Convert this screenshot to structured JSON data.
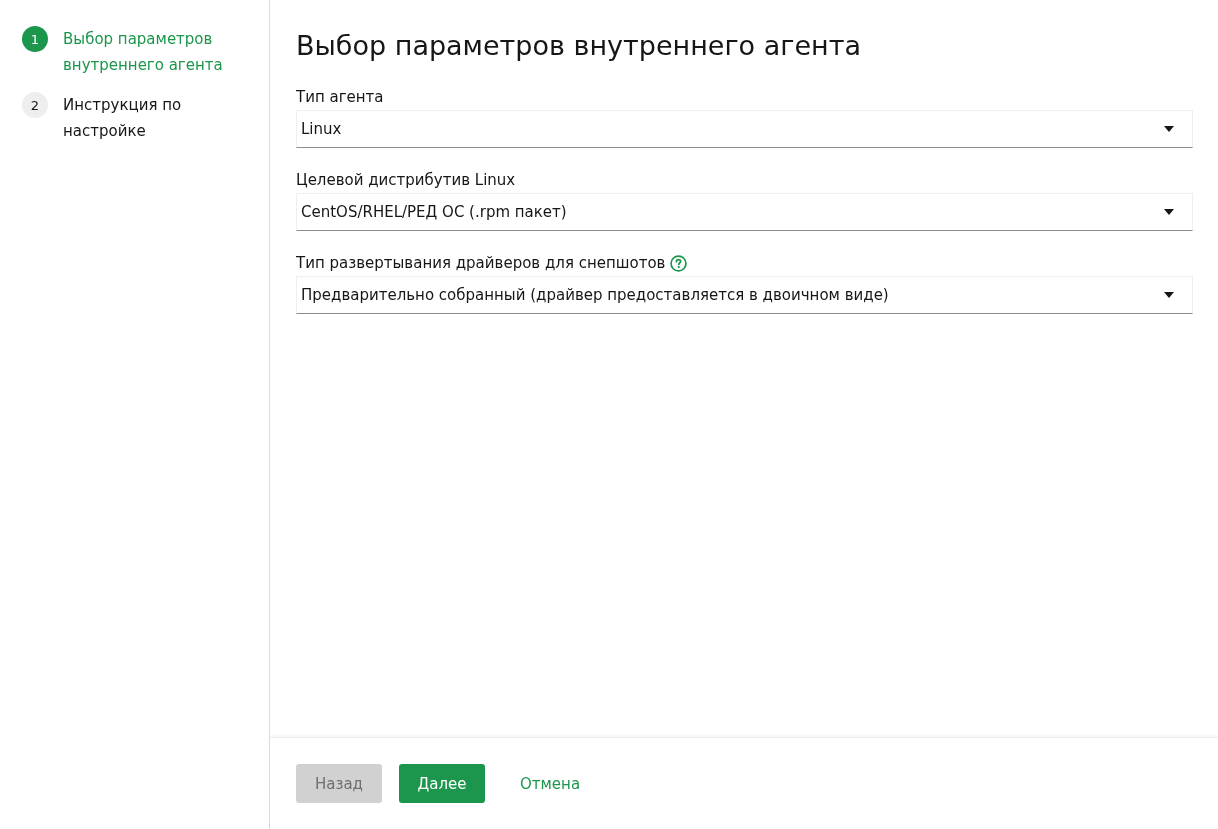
{
  "steps": [
    {
      "number": "1",
      "label": "Выбор параметров внутреннего агента",
      "selected": true
    },
    {
      "number": "2",
      "label": "Инструкция по настройке",
      "selected": false
    }
  ],
  "title": "Выбор параметров внутреннего агента",
  "fields": [
    {
      "label": "Тип агента",
      "value": "Linux",
      "help": false
    },
    {
      "label": "Целевой дистрибутив Linux",
      "value": "CentOS/RHEL/РЕД ОС (.rpm пакет)",
      "help": false
    },
    {
      "label": "Тип развертывания драйверов для снепшотов",
      "value": "Предварительно собранный (драйвер предоставляется в двоичном виде)",
      "help": true
    }
  ],
  "buttons": [
    {
      "label": "Назад",
      "kind": "secondary",
      "disabled": true
    },
    {
      "label": "Далее",
      "kind": "primary",
      "disabled": false
    },
    {
      "label": "Отмена",
      "kind": "link",
      "disabled": false
    }
  ]
}
